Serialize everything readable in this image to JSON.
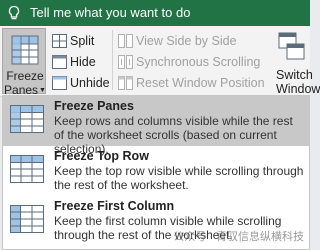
{
  "tell_me": {
    "text": "Tell me what you want to do",
    "icon": "lightbulb-icon"
  },
  "ribbon": {
    "freeze_panes": {
      "line1": "Freeze",
      "line2": "Panes",
      "icon": "freeze-panes-icon"
    },
    "split": "Split",
    "hide": "Hide",
    "unhide": "Unhide",
    "view_side_by_side": "View Side by Side",
    "synchronous_scrolling": "Synchronous Scrolling",
    "reset_window_position": "Reset Window Position",
    "switch_windows": {
      "line1": "Switch",
      "line2": "Windows"
    }
  },
  "menu": {
    "items": [
      {
        "title": "Freeze Panes",
        "description": "Keep rows and columns visible while the rest of the worksheet scrolls (based on current selection).",
        "selected": true
      },
      {
        "title": "Freeze Top Row",
        "description": "Keep the top row visible while scrolling through the rest of the worksheet.",
        "selected": false
      },
      {
        "title": "Freeze First Column",
        "description": "Keep the first column visible while scrolling through the rest of the worksheet.",
        "selected": false
      }
    ]
  },
  "watermark": "公众号 · 青驭信息纵横科技",
  "colors": {
    "title_bar": "#217346",
    "selected_item": "#c8c8c8"
  }
}
